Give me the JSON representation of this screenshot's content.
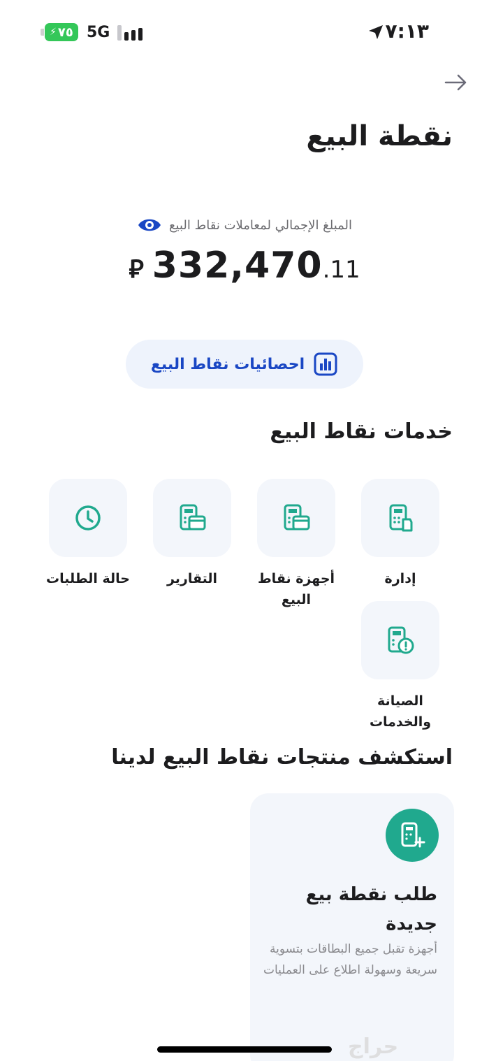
{
  "status_bar": {
    "battery": "٧٥",
    "network": "5G",
    "time": "٧:١٣"
  },
  "header": {
    "title": "نقطة البيع"
  },
  "balance": {
    "label": "المبلغ الإجمالي لمعاملات نقاط البيع",
    "amount_main": "332,470",
    "amount_decimal": ".11",
    "currency": "⃁"
  },
  "stats_button": {
    "label": "احصائيات نقاط البيع"
  },
  "services": {
    "title": "خدمات نقاط البيع",
    "items": [
      {
        "label": "إدارة",
        "icon": "pos-manage-icon"
      },
      {
        "label": "أجهزة نقاط البيع",
        "icon": "pos-devices-icon"
      },
      {
        "label": "التقارير",
        "icon": "reports-icon"
      },
      {
        "label": "حالة الطلبات",
        "icon": "clock-icon"
      },
      {
        "label": "الصيانة والخدمات",
        "icon": "maintenance-icon"
      }
    ]
  },
  "explore": {
    "title": "استكشف منتجات نقاط البيع لدينا",
    "card": {
      "title": "طلب نقطة بيع جديدة",
      "description": "أجهزة  تقبل جميع البطاقات بتسوية سريعة وسهولة اطلاع على العمليات"
    }
  },
  "watermark": "حراج",
  "colors": {
    "accent_blue": "#1a47c4",
    "accent_teal": "#20a98e",
    "battery_green": "#34c759"
  }
}
